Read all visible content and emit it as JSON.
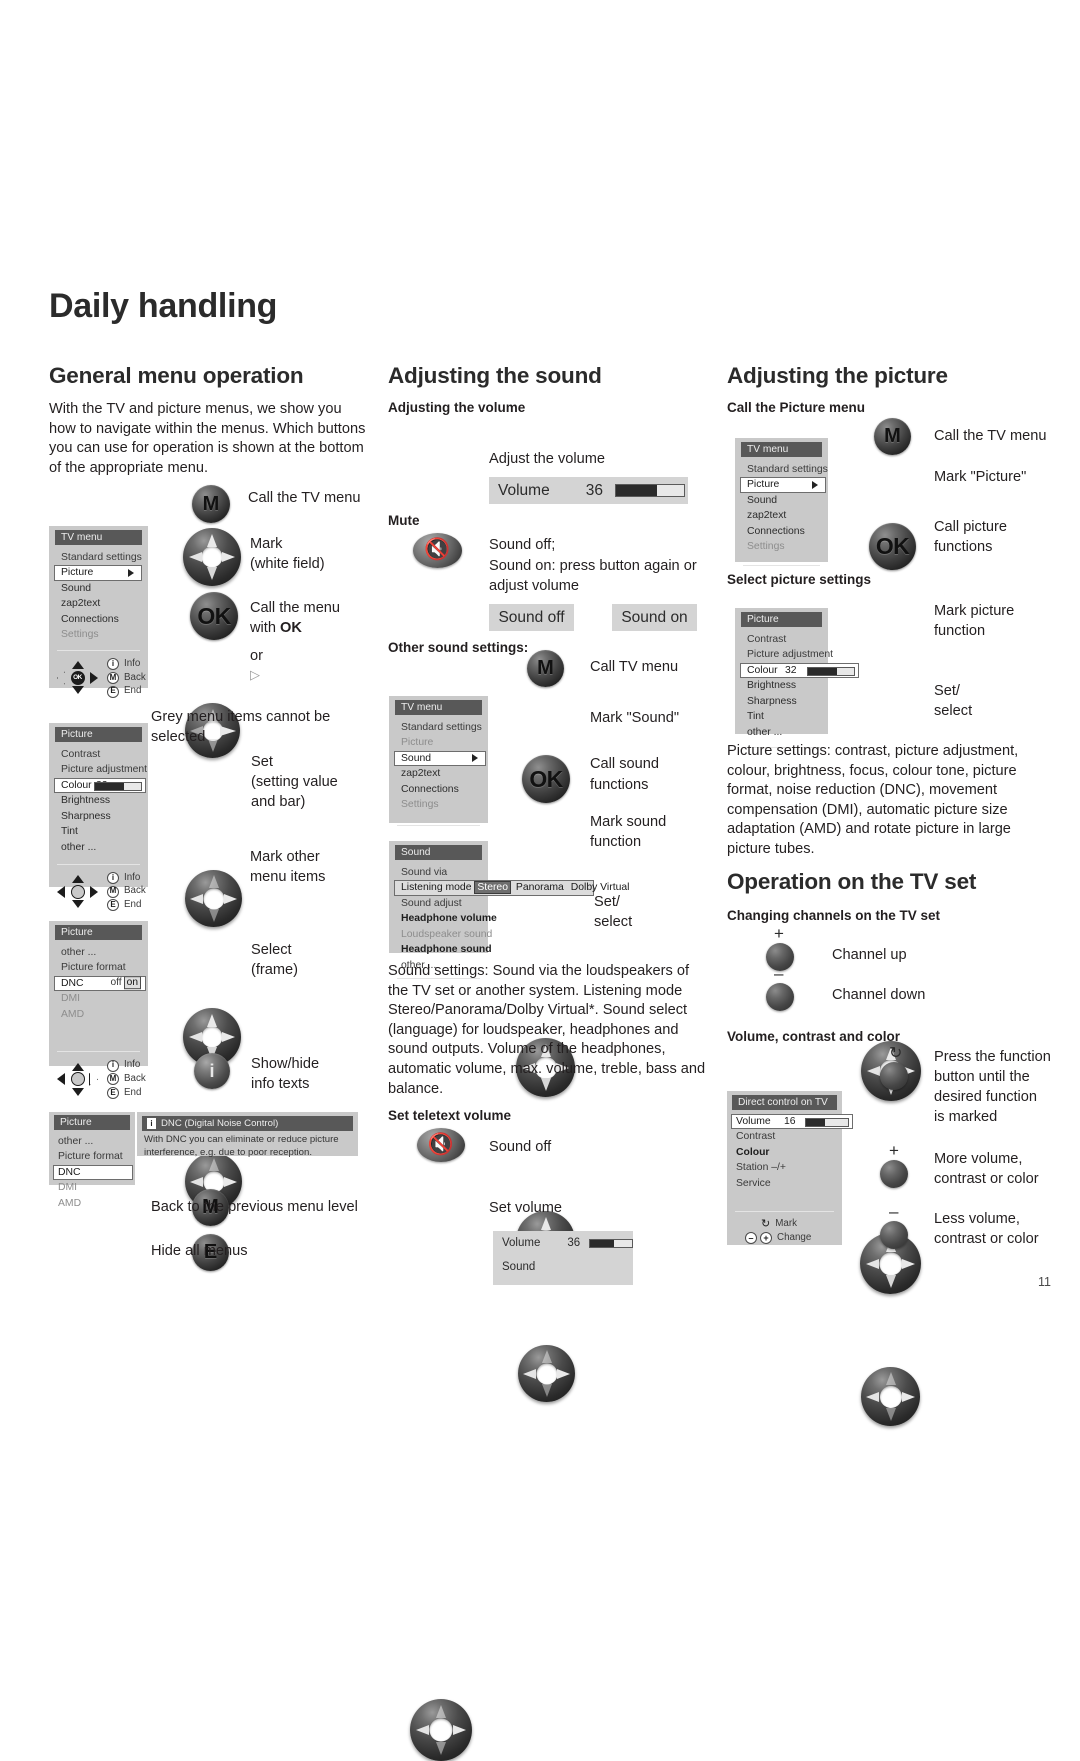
{
  "document": {
    "title": "Daily handling",
    "page_number": "11"
  },
  "column_left": {
    "heading": "General menu operation",
    "intro": "With the TV and picture menus, we show you how to navigate within the menus. Which buttons you can use for operation is shown at the bottom of the appropriate menu.",
    "note_grey": "Grey menu items cannot be selected",
    "steps": [
      {
        "button": "M",
        "caption_line1": "Call the TV menu",
        "caption_line2": ""
      },
      {
        "button": "dpad",
        "caption_line1": "Mark",
        "caption_line2": "(white field)"
      },
      {
        "button": "OK",
        "caption_line1": "Call the menu",
        "caption_line2": "with OK"
      },
      {
        "button": "dpad",
        "caption_line1": "or",
        "caption_line2": "▷"
      },
      {
        "button": "dpad",
        "caption_line1": "Set",
        "caption_line2": "(setting value",
        "caption_line3": "and bar)"
      },
      {
        "button": "dpad",
        "caption_line1": "Mark other",
        "caption_line2": "menu items"
      },
      {
        "button": "dpad",
        "caption_line1": "Select",
        "caption_line2": "(frame)"
      },
      {
        "button": "i",
        "caption_line1": "Show/hide",
        "caption_line2": "info texts"
      },
      {
        "button": "M",
        "caption_line1": "Back to the previous menu level",
        "caption_line2": ""
      },
      {
        "button": "E",
        "caption_line1": "Hide all menus",
        "caption_line2": ""
      }
    ],
    "menu_tv": {
      "title": "TV menu",
      "items": [
        {
          "label": "Standard settings",
          "state": "normal"
        },
        {
          "label": "Picture",
          "state": "selected",
          "arrow": true
        },
        {
          "label": "Sound",
          "state": "dark"
        },
        {
          "label": "zap2text",
          "state": "dark"
        },
        {
          "label": "Connections",
          "state": "dark"
        },
        {
          "label": "Settings",
          "state": "grey"
        }
      ],
      "nav": [
        {
          "key": "i",
          "label": "Info"
        },
        {
          "key": "M",
          "label": "Back"
        },
        {
          "key": "E",
          "label": "End"
        }
      ]
    },
    "menu_picture_1": {
      "title": "Picture",
      "items": [
        {
          "label": "Contrast",
          "state": "normal"
        },
        {
          "label": "Picture adjustment",
          "state": "normal"
        },
        {
          "label": "Colour",
          "state": "selected",
          "value": "32",
          "bar_percent": 62
        },
        {
          "label": "Brightness",
          "state": "dark"
        },
        {
          "label": "Sharpness",
          "state": "dark"
        },
        {
          "label": "Tint",
          "state": "dark"
        },
        {
          "label": "other ...",
          "state": "dark"
        }
      ],
      "nav": [
        {
          "key": "i",
          "label": "Info"
        },
        {
          "key": "M",
          "label": "Back"
        },
        {
          "key": "E",
          "label": "End"
        }
      ]
    },
    "menu_picture_2": {
      "title": "Picture",
      "items": [
        {
          "label": "other ...",
          "state": "normal"
        },
        {
          "label": "Picture format",
          "state": "normal"
        },
        {
          "label": "DNC",
          "state": "selected",
          "toggle_off": "off",
          "toggle_on": "on"
        },
        {
          "label": "DMI",
          "state": "grey"
        },
        {
          "label": "AMD",
          "state": "grey"
        }
      ],
      "nav": [
        {
          "key": "i",
          "label": "Info"
        },
        {
          "key": "M",
          "label": "Back"
        },
        {
          "key": "E",
          "label": "End"
        }
      ]
    },
    "menu_picture_3": {
      "title": "Picture",
      "items": [
        {
          "label": "other ...",
          "state": "normal"
        },
        {
          "label": "Picture format",
          "state": "normal"
        },
        {
          "label": "DNC",
          "state": "selected"
        },
        {
          "label": "DMI",
          "state": "grey"
        },
        {
          "label": "AMD",
          "state": "grey"
        }
      ]
    },
    "info_popup": {
      "icon": "i",
      "title": "DNC (Digital Noise Control)",
      "body": "With DNC you can eliminate or reduce picture interference, e.g. due to poor reception."
    }
  },
  "column_middle": {
    "heading": "Adjusting the sound",
    "sub_volume": "Adjusting the volume",
    "caption_adjust_volume": "Adjust the volume",
    "volume_osd": {
      "label": "Volume",
      "value": "36",
      "bar_percent": 60
    },
    "sub_mute": "Mute",
    "mute_line1": "Sound off;",
    "mute_line2": "Sound on: press button again or",
    "mute_line3": "adjust volume",
    "badge_sound_off": "Sound off",
    "badge_sound_on": "Sound on",
    "sub_other": "Other sound settings:",
    "steps": [
      {
        "button": "M",
        "caption_line1": "Call TV menu",
        "caption_line2": ""
      },
      {
        "button": "dpad",
        "caption_line1": "Mark \"Sound\"",
        "caption_line2": ""
      },
      {
        "button": "OK",
        "caption_line1": "Call sound",
        "caption_line2": "functions"
      },
      {
        "button": "dpad",
        "caption_line1": "Mark sound",
        "caption_line2": "function"
      },
      {
        "button": "dpad",
        "caption_line1": "Set/",
        "caption_line2": "select"
      }
    ],
    "menu_tv": {
      "title": "TV menu",
      "items": [
        {
          "label": "Standard settings",
          "state": "normal"
        },
        {
          "label": "Picture",
          "state": "grey"
        },
        {
          "label": "Sound",
          "state": "selected",
          "arrow": true
        },
        {
          "label": "zap2text",
          "state": "dark"
        },
        {
          "label": "Connections",
          "state": "dark"
        },
        {
          "label": "Settings",
          "state": "grey"
        }
      ]
    },
    "menu_sound": {
      "title": "Sound",
      "items": [
        {
          "label": "Sound via",
          "state": "normal"
        },
        {
          "label": "Listening mode",
          "state": "optionrow",
          "options": [
            "Stereo",
            "Panorama",
            "Dolby Virtual"
          ],
          "selected": "Stereo"
        },
        {
          "label": "Sound adjust",
          "state": "normal"
        },
        {
          "label": "Headphone volume",
          "state": "bold"
        },
        {
          "label": "Loudspeaker sound",
          "state": "grey"
        },
        {
          "label": "Headphone sound",
          "state": "bold"
        },
        {
          "label": "other ...",
          "state": "normal"
        }
      ]
    },
    "body_text": "Sound settings: Sound via the loudspeakers of the TV set or another system. Listening mode Stereo/Panorama/Dolby Virtual*. Sound select (language) for loudspeaker, headphones and sound outputs. Volume of the headphones, automatic volume, max. volume, treble, bass and balance.",
    "sub_teletext": "Set teletext volume",
    "teletext_steps": [
      {
        "button": "mute",
        "caption": "Sound off"
      },
      {
        "button": "dpad",
        "caption": "Set volume"
      }
    ],
    "teletext_osd": {
      "label": "Volume",
      "value": "36",
      "bar_percent": 58,
      "second_label": "Sound"
    }
  },
  "column_right": {
    "heading": "Adjusting the picture",
    "sub_call_picture": "Call the Picture menu",
    "steps_call": [
      {
        "button": "M",
        "caption_line1": "Call the TV menu",
        "caption_line2": ""
      },
      {
        "button": "dpad",
        "caption_line1": "Mark \"Picture\"",
        "caption_line2": ""
      },
      {
        "button": "OK",
        "caption_line1": "Call picture",
        "caption_line2": "functions"
      }
    ],
    "menu_tv": {
      "title": "TV menu",
      "items": [
        {
          "label": "Standard settings",
          "state": "normal"
        },
        {
          "label": "Picture",
          "state": "selected",
          "arrow": true
        },
        {
          "label": "Sound",
          "state": "dark"
        },
        {
          "label": "zap2text",
          "state": "dark"
        },
        {
          "label": "Connections",
          "state": "dark"
        },
        {
          "label": "Settings",
          "state": "grey"
        }
      ]
    },
    "sub_select_picture": "Select picture settings",
    "steps_select": [
      {
        "button": "dpad",
        "caption_line1": "Mark picture",
        "caption_line2": "function"
      },
      {
        "button": "dpad",
        "caption_line1": "Set/",
        "caption_line2": "select"
      }
    ],
    "menu_picture": {
      "title": "Picture",
      "items": [
        {
          "label": "Contrast",
          "state": "normal"
        },
        {
          "label": "Picture adjustment",
          "state": "normal"
        },
        {
          "label": "Colour",
          "state": "selected",
          "value": "32",
          "bar_percent": 62
        },
        {
          "label": "Brightness",
          "state": "dark"
        },
        {
          "label": "Sharpness",
          "state": "dark"
        },
        {
          "label": "Tint",
          "state": "dark"
        },
        {
          "label": "other ...",
          "state": "dark"
        }
      ]
    },
    "body_text": "Picture settings: contrast, picture adjustment, colour, brightness, focus, colour tone, picture format, noise reduction (DNC), movement compensation (DMI), automatic picture size adaptation (AMD) and rotate picture in large picture tubes.",
    "heading_tvset": "Operation on the TV set",
    "sub_channels": "Changing channels on the TV set",
    "channel_steps": [
      {
        "sign": "+",
        "caption": "Channel up"
      },
      {
        "sign": "–",
        "caption": "Channel down"
      }
    ],
    "sub_vcc": "Volume, contrast and color",
    "vcc_steps": [
      {
        "sign": "↻",
        "caption_line1": "Press the function",
        "caption_line2": "button until the",
        "caption_line3": "desired function",
        "caption_line4": "is marked"
      },
      {
        "sign": "+",
        "caption_line1": "More volume,",
        "caption_line2": "contrast or color"
      },
      {
        "sign": "–",
        "caption_line1": "Less volume,",
        "caption_line2": "contrast or color"
      }
    ],
    "menu_direct": {
      "title": "Direct control on TV",
      "items": [
        {
          "label": "Volume",
          "state": "selected",
          "value": "16",
          "bar_percent": 46
        },
        {
          "label": "Contrast",
          "state": "normal"
        },
        {
          "label": "Colour",
          "state": "bold"
        },
        {
          "label": "Station –/+",
          "state": "normal"
        },
        {
          "label": "Service",
          "state": "normal"
        }
      ],
      "nav": [
        {
          "key": "↻",
          "label": "Mark"
        },
        {
          "key": "– +",
          "label": "Change"
        }
      ]
    }
  }
}
